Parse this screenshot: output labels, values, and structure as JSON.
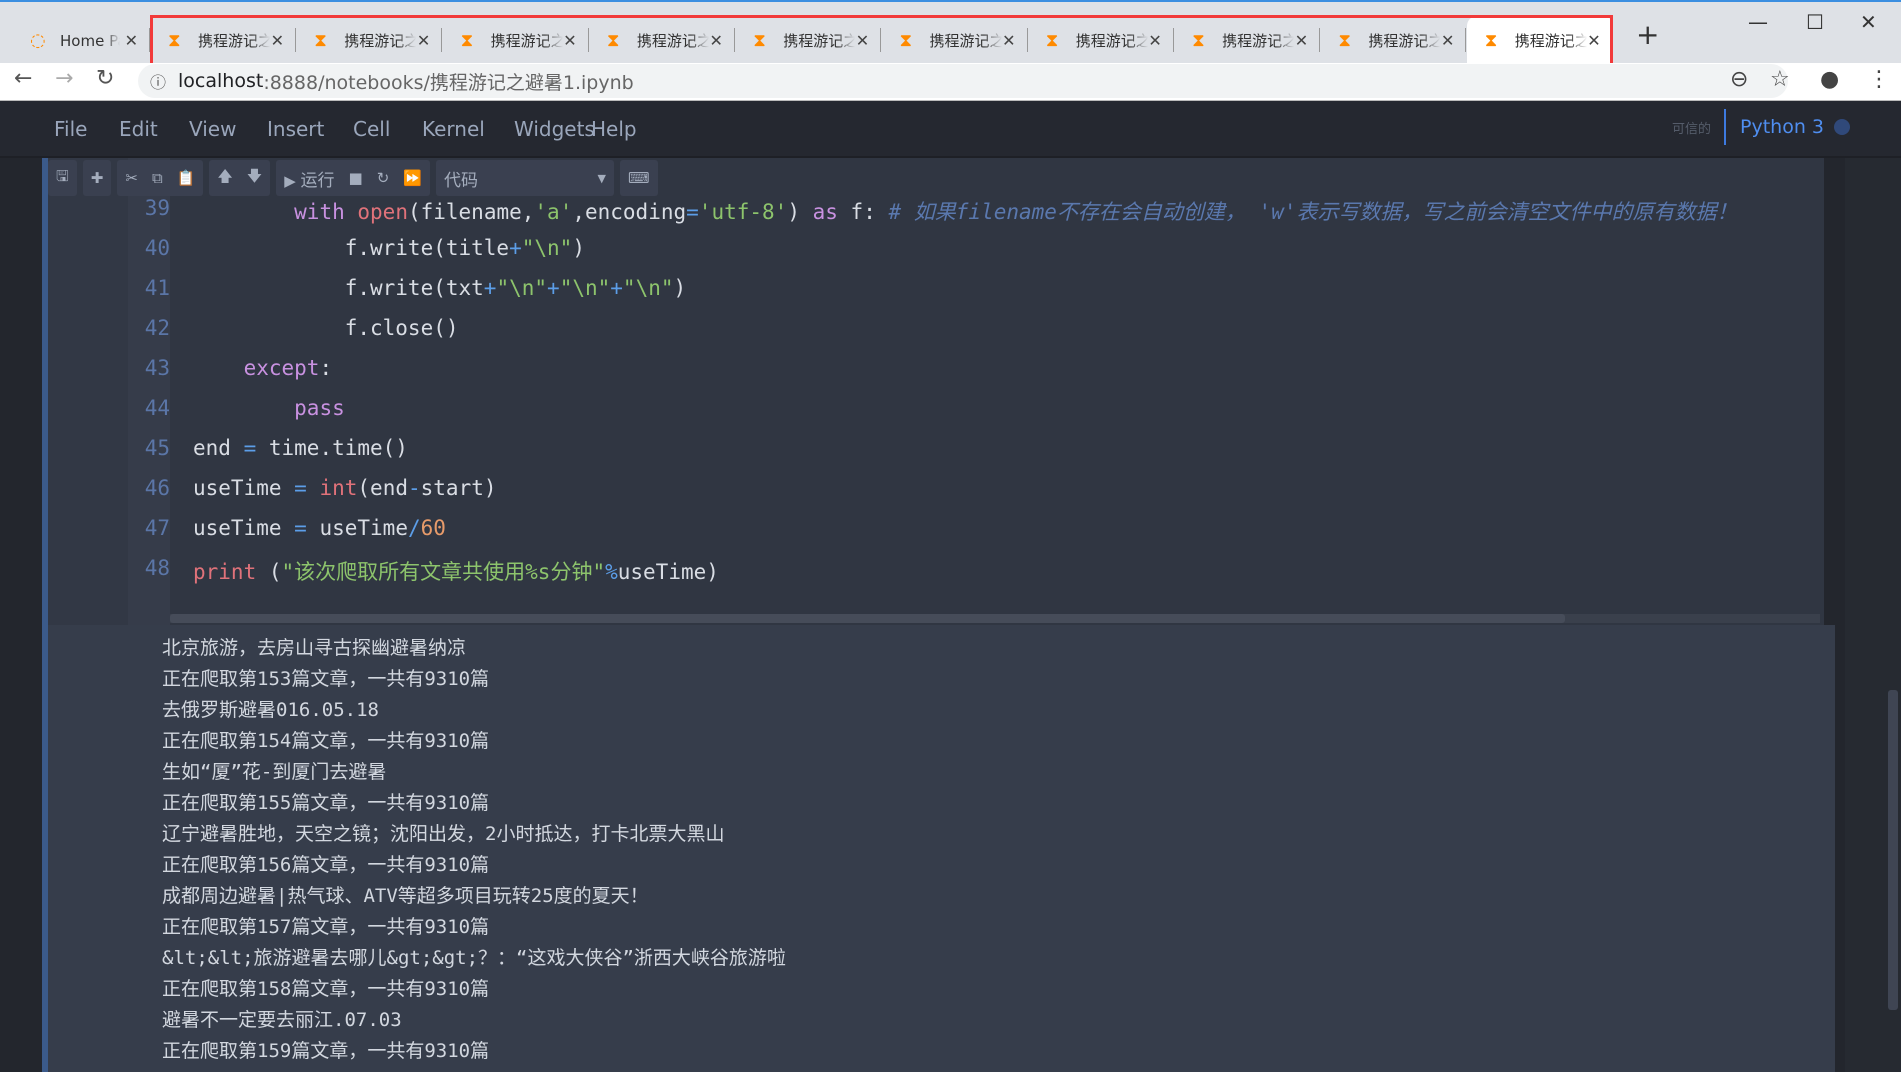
{
  "browser": {
    "tabs": [
      {
        "label": "Home Page",
        "icon": "jupyter-logo-icon",
        "active": false
      },
      {
        "label": "携程游记之避暑",
        "icon": "hourglass-icon",
        "active": false
      },
      {
        "label": "携程游记之避暑",
        "icon": "hourglass-icon",
        "active": false
      },
      {
        "label": "携程游记之避暑",
        "icon": "hourglass-icon",
        "active": false
      },
      {
        "label": "携程游记之避暑",
        "icon": "hourglass-icon",
        "active": false
      },
      {
        "label": "携程游记之避暑",
        "icon": "hourglass-icon",
        "active": false
      },
      {
        "label": "携程游记之避暑",
        "icon": "hourglass-icon",
        "active": false
      },
      {
        "label": "携程游记之避暑",
        "icon": "hourglass-icon",
        "active": false
      },
      {
        "label": "携程游记之避暑",
        "icon": "hourglass-icon",
        "active": false
      },
      {
        "label": "携程游记之避暑",
        "icon": "hourglass-icon",
        "active": false
      },
      {
        "label": "携程游记之避暑",
        "icon": "hourglass-icon",
        "active": true
      }
    ],
    "highlight_color": "#f23a3a",
    "url_host": "localhost",
    "url_path": ":8888/notebooks/携程游记之避暑1.ipynb"
  },
  "menu": {
    "items": [
      "File",
      "Edit",
      "View",
      "Insert",
      "Cell",
      "Kernel",
      "Widgets",
      "Help"
    ],
    "trusted": "可信的",
    "kernel": "Python 3"
  },
  "toolbar": {
    "run_label": "运行",
    "cell_type": "代码"
  },
  "code": {
    "lines": [
      {
        "n": "39",
        "html": "        <span class=\"kw\">with</span> <span class=\"fn\">open</span>(filename,<span class=\"st\">'a'</span>,encoding<span class=\"op\">=</span><span class=\"st\">'utf-8'</span>) <span class=\"kw\">as</span> f: <span class=\"cm\"># 如果filename不存在会自动创建， 'w'表示写数据，写之前会清空文件中的原有数据！</span>"
      },
      {
        "n": "40",
        "html": "            f.write(title<span class=\"op\">+</span><span class=\"st\">\"\\n\"</span>)"
      },
      {
        "n": "41",
        "html": "            f.write(txt<span class=\"op\">+</span><span class=\"st\">\"\\n\"</span><span class=\"op\">+</span><span class=\"st\">\"\\n\"</span><span class=\"op\">+</span><span class=\"st\">\"\\n\"</span>)"
      },
      {
        "n": "42",
        "html": "            f.close()"
      },
      {
        "n": "43",
        "html": "    <span class=\"kw\">except</span>:"
      },
      {
        "n": "44",
        "html": "        <span class=\"kw\">pass</span>"
      },
      {
        "n": "45",
        "html": "end <span class=\"op\">=</span> time.time()"
      },
      {
        "n": "46",
        "html": "useTime <span class=\"op\">=</span> <span class=\"fn\">int</span>(end<span class=\"op\">-</span>start)"
      },
      {
        "n": "47",
        "html": "useTime <span class=\"op\">=</span> useTime<span class=\"op\">/</span><span class=\"nm\">60</span>"
      },
      {
        "n": "48",
        "html": "<span class=\"fn\">print</span> (<span class=\"st\">\"该次爬取所有文章共使用%s分钟\"</span><span class=\"op\">%</span>useTime)"
      }
    ]
  },
  "output": [
    "北京旅游，去房山寻古探幽避暑纳凉",
    "正在爬取第153篇文章，一共有9310篇",
    "去俄罗斯避暑016.05.18",
    "正在爬取第154篇文章，一共有9310篇",
    "生如“厦”花-到厦门去避暑",
    "正在爬取第155篇文章，一共有9310篇",
    "辽宁避暑胜地，天空之镜；沈阳出发，2小时抵达，打卡北票大黑山",
    "正在爬取第156篇文章，一共有9310篇",
    "成都周边避暑|热气球、ATV等超多项目玩转25度的夏天！",
    "正在爬取第157篇文章，一共有9310篇",
    "&lt;&lt;旅游避暑去哪儿&gt;&gt;？：“这戏大侠谷”浙西大峡谷旅游啦",
    "正在爬取第158篇文章，一共有9310篇",
    "避暑不一定要去丽江.07.03",
    "正在爬取第159篇文章，一共有9310篇"
  ]
}
